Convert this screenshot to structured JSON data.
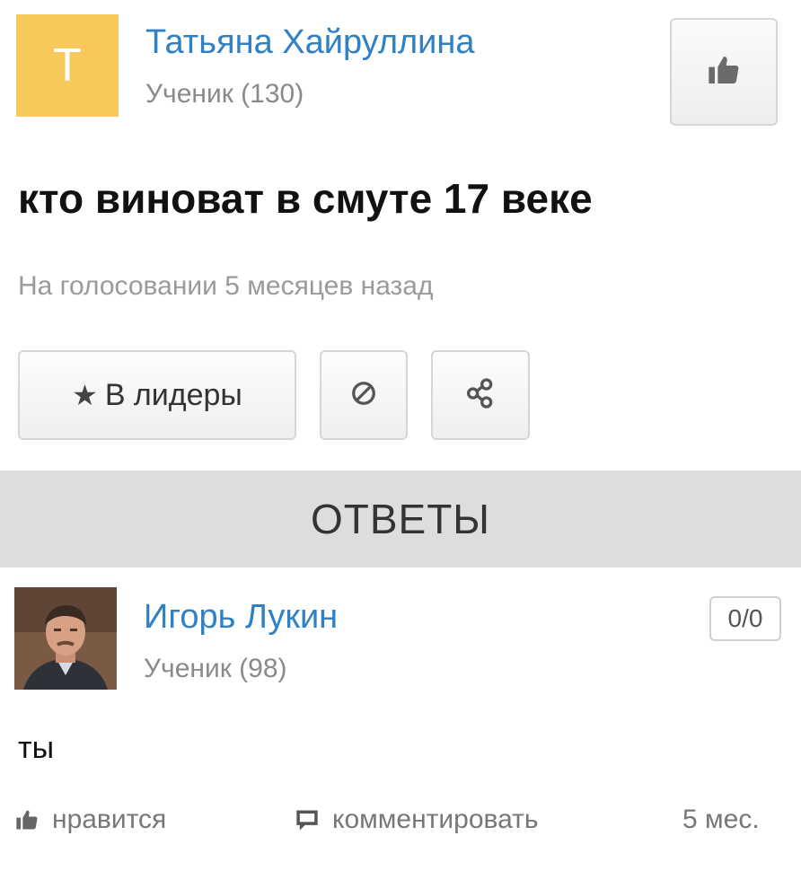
{
  "question": {
    "author": {
      "avatar_letter": "T",
      "avatar_color": "#f6c95a",
      "name": "Татьяна Хайруллина",
      "rank": "Ученик (130)"
    },
    "like_icon": "thumbs-up-icon",
    "title": "кто виноват в смуте 17 веке",
    "status": "На голосовании 5 месяцев назад",
    "actions": {
      "leaders_star_icon": "star-icon",
      "leaders_star": "★",
      "leaders_label": "В лидеры",
      "block_icon": "block-icon",
      "share_icon": "share-icon"
    }
  },
  "answers_header": "ОТВЕТЫ",
  "answers": [
    {
      "author": {
        "name": "Игорь Лукин",
        "rank": "Ученик (98)"
      },
      "votes": "0/0",
      "text": "ты",
      "footer": {
        "like_label": "нравится",
        "comment_label": "комментировать",
        "time": "5 мес."
      }
    }
  ],
  "colors": {
    "link": "#2f80c4",
    "muted": "#8a8a8a",
    "header_bg": "#dddddd"
  }
}
